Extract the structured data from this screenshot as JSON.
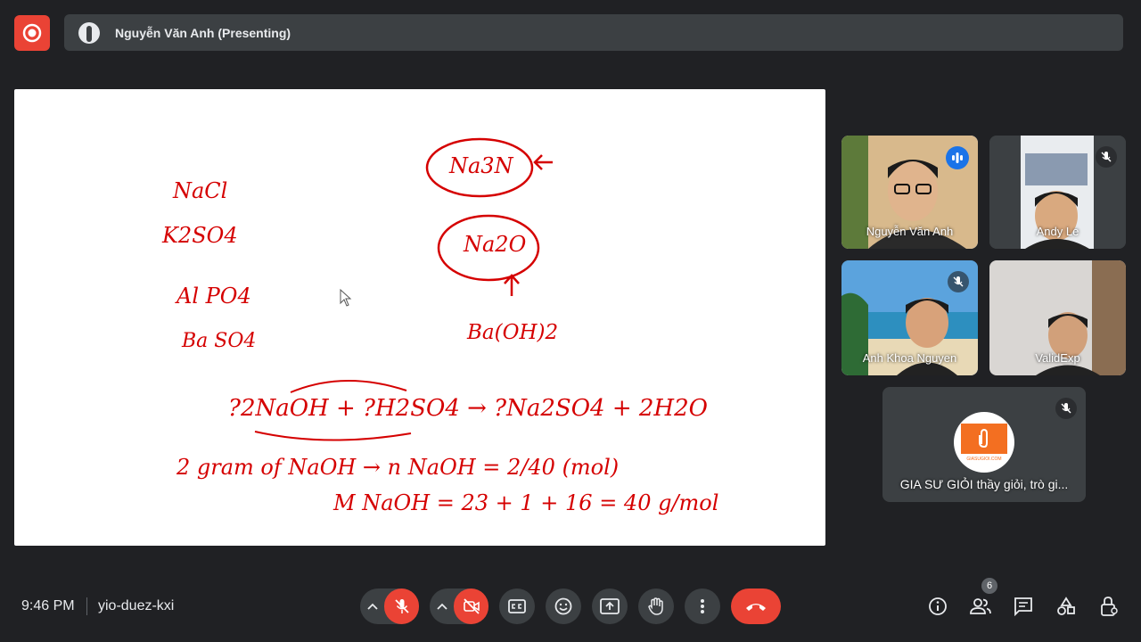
{
  "presenter": {
    "name": "Nguyễn Văn Anh (Presenting)"
  },
  "board": {
    "left_list": [
      "NaCl",
      "K2SO4",
      "Al PO4",
      "Ba SO4"
    ],
    "mid": {
      "top": "Na3N",
      "second": "Na2O",
      "base": "Ba(OH)2"
    },
    "equation": "?2NaOH + ?H2SO4 → ?Na2SO4 + 2H2O",
    "line2": "2 gram of NaOH → n NaOH = 2/40 (mol)",
    "line3": "M NaOH = 23 + 1 + 16 = 40 g/mol"
  },
  "participants": [
    {
      "name": "Nguyễn Văn Anh",
      "speaking": true
    },
    {
      "name": "Andy Le",
      "muted": true
    },
    {
      "name": "Anh Khoa Nguyen",
      "muted": true
    },
    {
      "name": "ValidExp"
    },
    {
      "name": "GIA SƯ GIỎI thầy giỏi, trò gi...",
      "muted": true,
      "logo_text": "GIASUGIOI.COM"
    }
  ],
  "meeting": {
    "time": "9:46 PM",
    "code": "yio-duez-kxi",
    "participant_count": "6"
  },
  "colors": {
    "background": "#202124",
    "control": "#3c4043",
    "danger": "#ea4335",
    "accent": "#1a73e8",
    "ink": "#d50000"
  }
}
